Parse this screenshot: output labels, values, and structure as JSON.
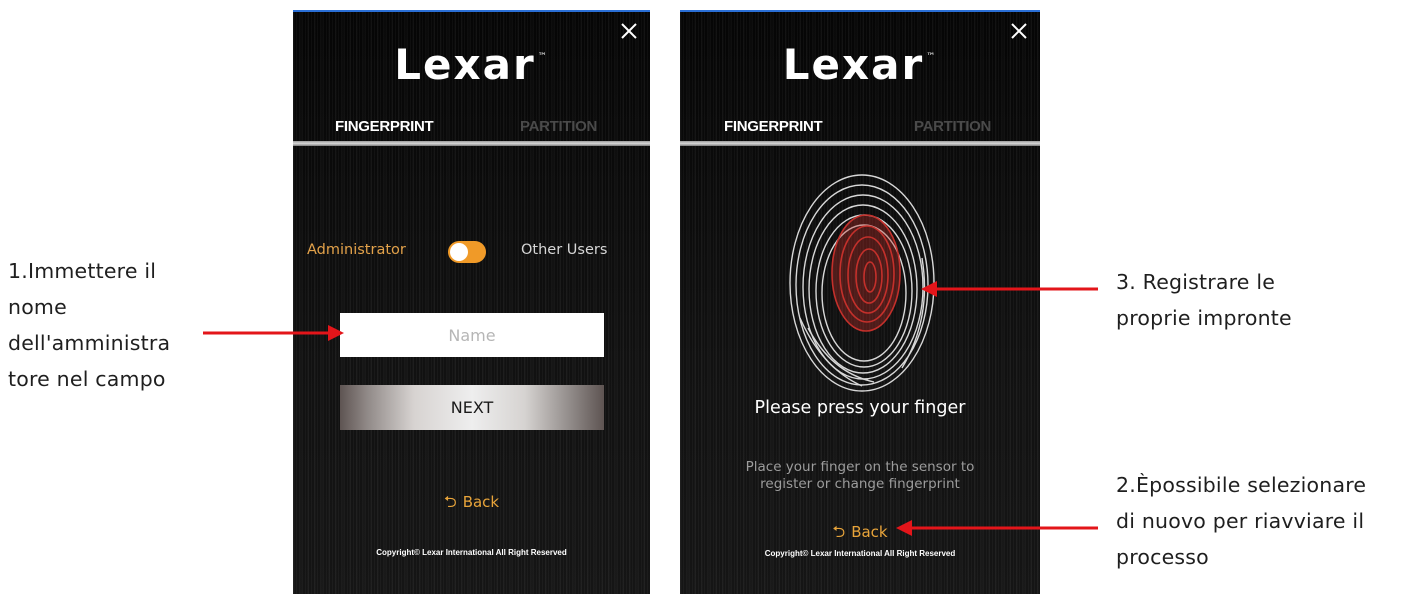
{
  "annotations": {
    "step1": [
      "1.Immettere  il",
      "nome",
      "dell'amministra",
      "tore nel campo"
    ],
    "step2": [
      "2.Èpossibile selezionare",
      "di nuovo per riavviare il",
      "processo"
    ],
    "step3": [
      "3. Registrare le",
      "proprie impronte"
    ]
  },
  "left_panel": {
    "logo": "Lexar",
    "logo_tm": "™",
    "tabs": {
      "fingerprint": "FINGERPRINT",
      "partition": "PARTITION"
    },
    "role_admin": "Administrator",
    "role_other": "Other Users",
    "name_placeholder": "Name",
    "next_label": "NEXT",
    "back_label": "Back",
    "copyright": "Copyright© Lexar International All Right Reserved"
  },
  "right_panel": {
    "logo": "Lexar",
    "logo_tm": "™",
    "tabs": {
      "fingerprint": "FINGERPRINT",
      "partition": "PARTITION"
    },
    "press_title": "Please press your finger",
    "instructions_line1": "Place your finger on the sensor to",
    "instructions_line2": "register or change fingerprint",
    "back_label": "Back",
    "copyright": "Copyright© Lexar International All Right Reserved"
  },
  "colors": {
    "accent": "#e8a43a",
    "toggle": "#f09a28",
    "arrow": "#e3151a",
    "panel_bg": "#0b0b0b",
    "fingerprint_highlight": "#c4302b"
  }
}
